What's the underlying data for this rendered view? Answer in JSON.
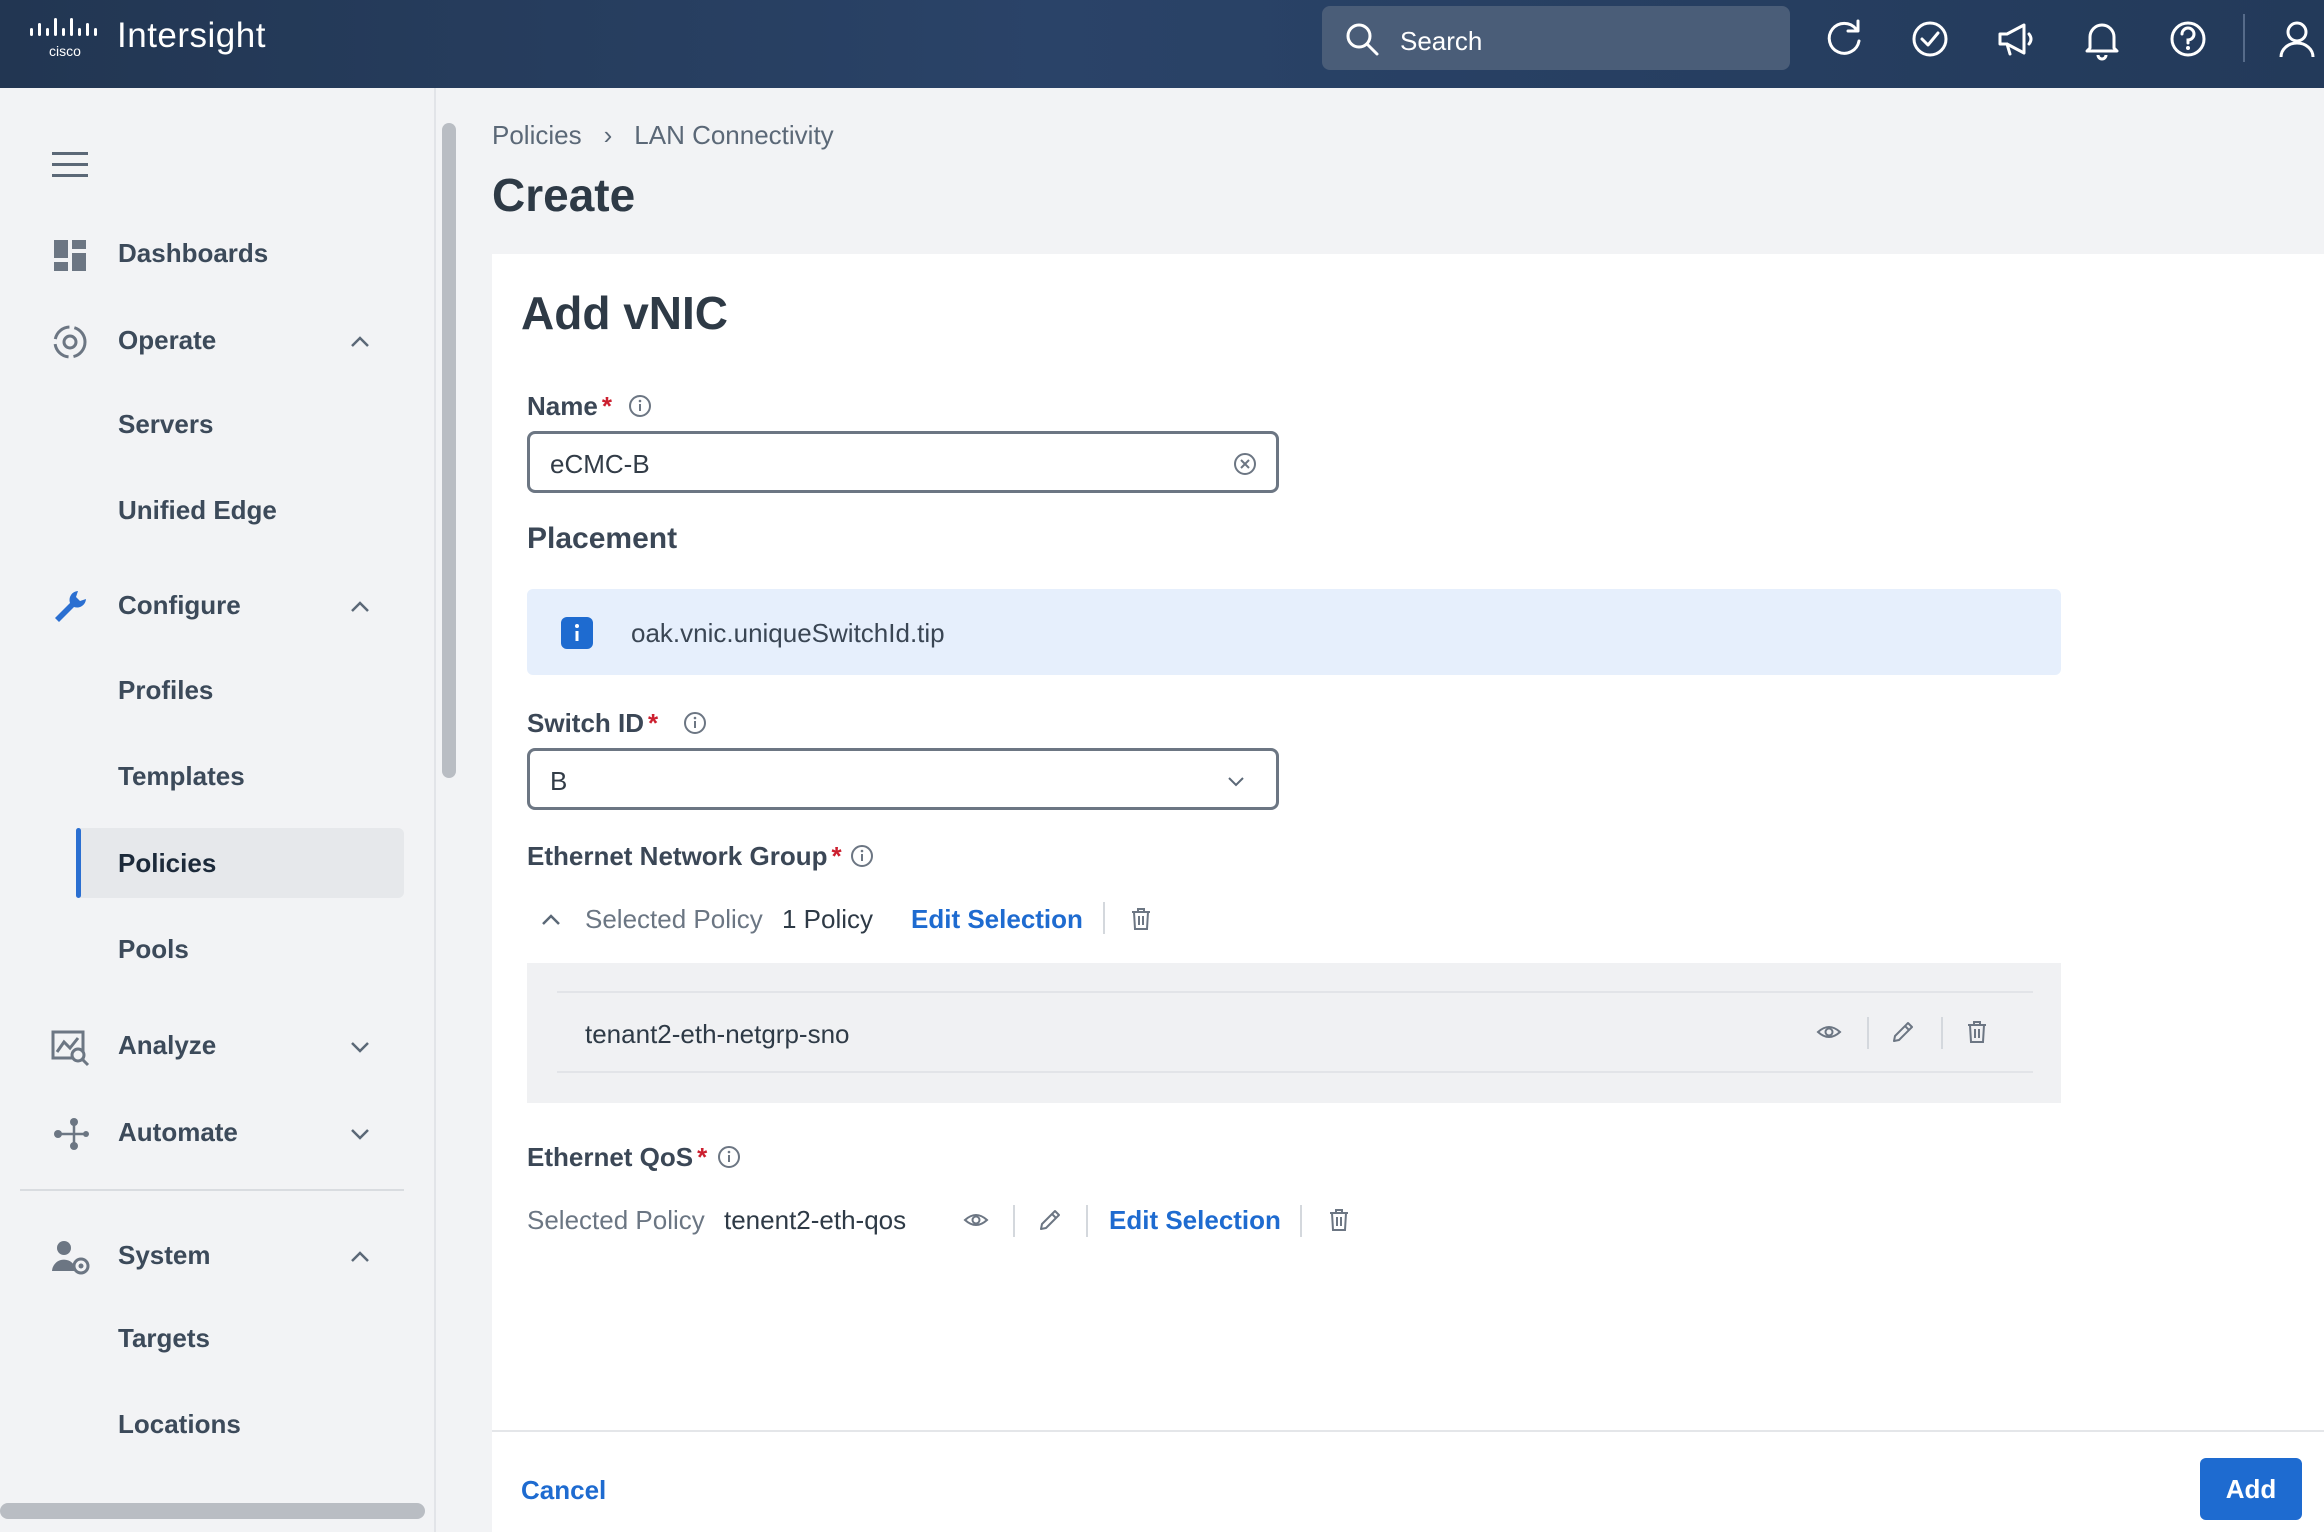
{
  "app": {
    "title": "Intersight",
    "logo_text": "cisco"
  },
  "topbar": {
    "search_placeholder": "Search",
    "icons": [
      "refresh-icon",
      "tasks-check-icon",
      "announcement-megaphone-icon",
      "notification-bell-icon",
      "help-icon",
      "user-icon"
    ]
  },
  "sidebar": {
    "items": [
      {
        "label": "Dashboards",
        "icon": "dashboard-icon"
      },
      {
        "label": "Operate",
        "icon": "operate-icon",
        "expanded": true,
        "children": [
          {
            "label": "Servers"
          },
          {
            "label": "Unified Edge"
          }
        ]
      },
      {
        "label": "Configure",
        "icon": "wrench-icon",
        "expanded": true,
        "children": [
          {
            "label": "Profiles"
          },
          {
            "label": "Templates"
          },
          {
            "label": "Policies",
            "active": true
          },
          {
            "label": "Pools"
          }
        ]
      },
      {
        "label": "Analyze",
        "icon": "analyze-icon",
        "expanded": false
      },
      {
        "label": "Automate",
        "icon": "automate-icon",
        "expanded": false
      },
      {
        "label": "System",
        "icon": "system-user-gear-icon",
        "expanded": true,
        "children": [
          {
            "label": "Targets"
          },
          {
            "label": "Locations"
          }
        ]
      }
    ]
  },
  "breadcrumb": [
    "Policies",
    "LAN Connectivity"
  ],
  "page_title": "Create",
  "form": {
    "title": "Add vNIC",
    "name": {
      "label": "Name",
      "required_mark": "*",
      "value": "eCMC-B"
    },
    "placement": {
      "title": "Placement",
      "info_text": "oak.vnic.uniqueSwitchId.tip"
    },
    "switch_id": {
      "label": "Switch ID",
      "required_mark": "*",
      "value": "B"
    },
    "ethernet_network_group": {
      "label": "Ethernet Network Group",
      "required_mark": "*",
      "selected_label": "Selected Policy",
      "selected_count": "1 Policy",
      "edit_label": "Edit Selection",
      "policies": [
        "tenant2-eth-netgrp-sno"
      ]
    },
    "ethernet_qos": {
      "label": "Ethernet QoS",
      "required_mark": "*",
      "selected_label": "Selected Policy",
      "selected_value": "tenent2-eth-qos",
      "edit_label": "Edit Selection"
    }
  },
  "footer": {
    "cancel_label": "Cancel",
    "add_label": "Add"
  },
  "colors": {
    "accent": "#1e6bd0",
    "required": "#cc1f2f",
    "topbar": "#2a4368"
  }
}
